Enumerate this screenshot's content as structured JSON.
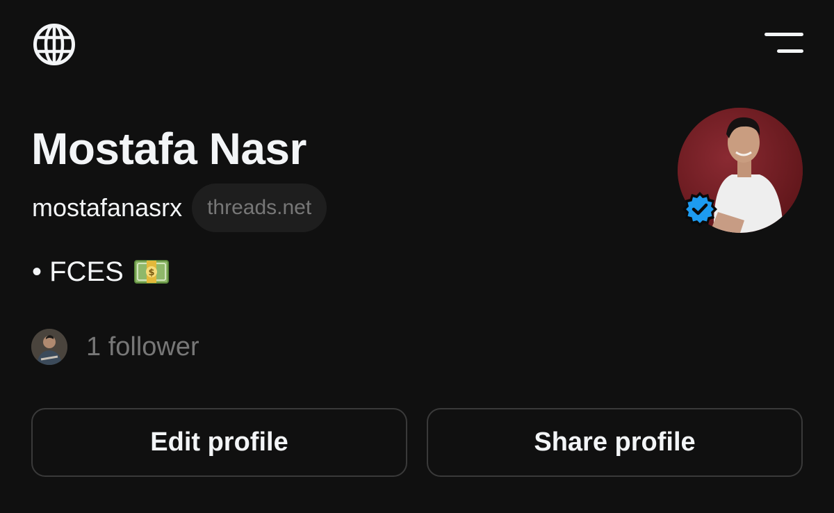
{
  "header": {
    "globe_icon": "globe-icon",
    "menu_icon": "hamburger-menu-icon"
  },
  "profile": {
    "display_name": "Mostafa Nasr",
    "username": "mostafanasrx",
    "domain_badge": "threads.net",
    "bio": "• FCES",
    "bio_emoji": "money-bag-emoji",
    "verified": true,
    "accent_verified": "#1d9bf0"
  },
  "followers": {
    "label": "1 follower"
  },
  "actions": {
    "edit_label": "Edit profile",
    "share_label": "Share profile"
  }
}
